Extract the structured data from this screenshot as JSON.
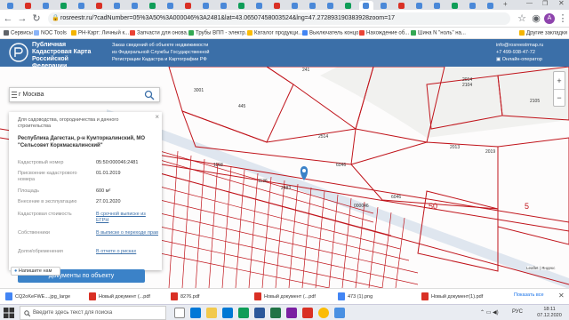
{
  "browser": {
    "url": "rosreestr.ru/?cadNumber=05%3A50%3A000046%3A2481&lat=43.06507458003524&lng=47.272893190383928zoom=17",
    "bookmarks": [
      "Сервисы",
      "NOC Tools",
      "РН-Карт: Личный к...",
      "Запчасти для онова...",
      "Трубы ВПП - электр...",
      "Каталог продукци...",
      "Выключатель концо...",
      "Нахождение об...",
      "Шина N \"ноль\" на...",
      "Другие закладки"
    ]
  },
  "site": {
    "title_line1": "Публичная",
    "title_line2": "Кадастровая Карта",
    "title_line3": "Российской Федерации",
    "desc_line1": "Заказ сведений об объекте недвижимости",
    "desc_line2": "из Федеральной Службы Государственной",
    "desc_line3": "Регистрации Кадастра и Картографии РФ",
    "email": "info@rosreestrmap.ru",
    "phone": "+7 499-938-47-72",
    "online": "Онлайн-оператор",
    "brand_color": "#3b6fa8"
  },
  "search": {
    "value": "г Москва"
  },
  "card": {
    "type_text": "Для садоводства, огородничества и дачного строительства",
    "address": "Республика Дагестан, р-н Кумторкалинский, МО \"Сельсовет Коркмаскалинский\"",
    "rows": [
      {
        "k": "Кадастровый номер",
        "v": "05:50:000046:2481"
      },
      {
        "k": "Присвоение кадастрового номера",
        "v": "01.01.2019"
      },
      {
        "k": "Площадь",
        "v": "600 м²"
      },
      {
        "k": "Внесение в эксплуатацию",
        "v": "27.01.2020"
      },
      {
        "k": "Кадастровая стоимость",
        "v": "В срочной выписке из ЕГРН"
      },
      {
        "k": "Собственники",
        "v": "В выписке о переходе прав"
      },
      {
        "k": "Долги/обременения",
        "v": "В отчете о рисках"
      }
    ],
    "objects_button": "Документы по объекту",
    "write_button": "Напишите нам"
  },
  "map": {
    "labels": [
      "241",
      "3001",
      "2014",
      "2104",
      "2105",
      "445",
      "2514",
      "2013",
      "2019",
      "6046",
      "6046",
      "50",
      "5",
      "000046",
      "1168",
      "1136",
      "2483"
    ],
    "attribution": "Leaflet | Яндекс"
  },
  "downloads": [
    {
      "name": "CQ2oKeFWE....jpg_large",
      "color": "#4285f4"
    },
    {
      "name": "Новый документ (...pdf",
      "color": "#d93025"
    },
    {
      "name": "8276.pdf",
      "color": "#d93025"
    },
    {
      "name": "Новый документ (...pdf",
      "color": "#d93025"
    },
    {
      "name": "473 (1).png",
      "color": "#4285f4"
    },
    {
      "name": "Новый документ(1).pdf",
      "color": "#d93025"
    }
  ],
  "downloads_show_all": "Показать все",
  "taskbar": {
    "search_placeholder": "Введите здесь текст для поиска",
    "lang": "РУС",
    "time": "18:11",
    "date": "07.12.2020"
  }
}
